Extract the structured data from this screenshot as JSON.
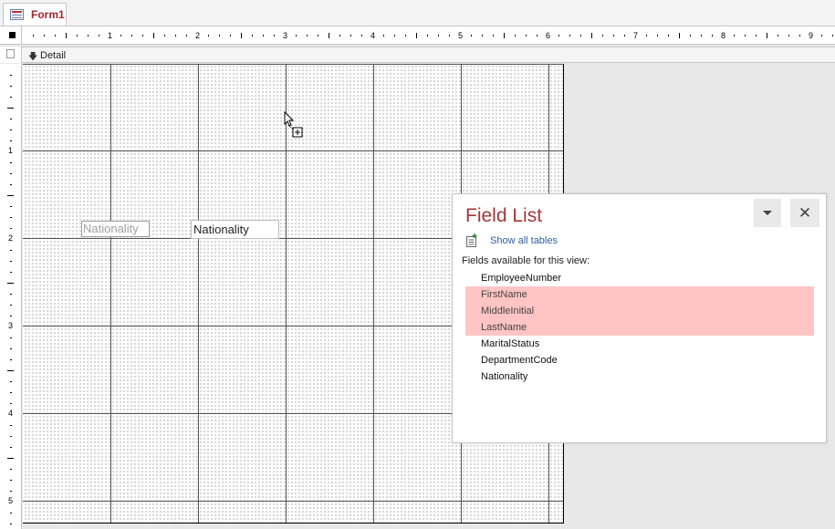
{
  "document_tab": {
    "label": "Form1",
    "icon": "form-icon"
  },
  "ruler": {
    "horizontal_numbers": [
      "1",
      "2",
      "3",
      "4",
      "5",
      "6",
      "7",
      "8",
      "9"
    ],
    "vertical_numbers": [
      "1",
      "2",
      "3",
      "4",
      "5"
    ]
  },
  "section": {
    "label": "Detail",
    "icon": "section-arrow-icon"
  },
  "controls": {
    "label_text": "Nationality",
    "textbox_text": "Nationality"
  },
  "field_list": {
    "title": "Field List",
    "show_all_link": "Show all tables",
    "caption": "Fields available for this view:",
    "fields": [
      {
        "name": "EmployeeNumber",
        "selected": false
      },
      {
        "name": "FirstName",
        "selected": true
      },
      {
        "name": "MiddleInitial",
        "selected": true
      },
      {
        "name": "LastName",
        "selected": true
      },
      {
        "name": "MaritalStatus",
        "selected": false
      },
      {
        "name": "DepartmentCode",
        "selected": false
      },
      {
        "name": "Nationality",
        "selected": false
      }
    ],
    "close_icon": "close-icon",
    "dropdown_icon": "chevron-down-icon"
  },
  "colors": {
    "accent": "#a4262c",
    "selection": "#ffc4c4",
    "link": "#2e5e9e"
  }
}
